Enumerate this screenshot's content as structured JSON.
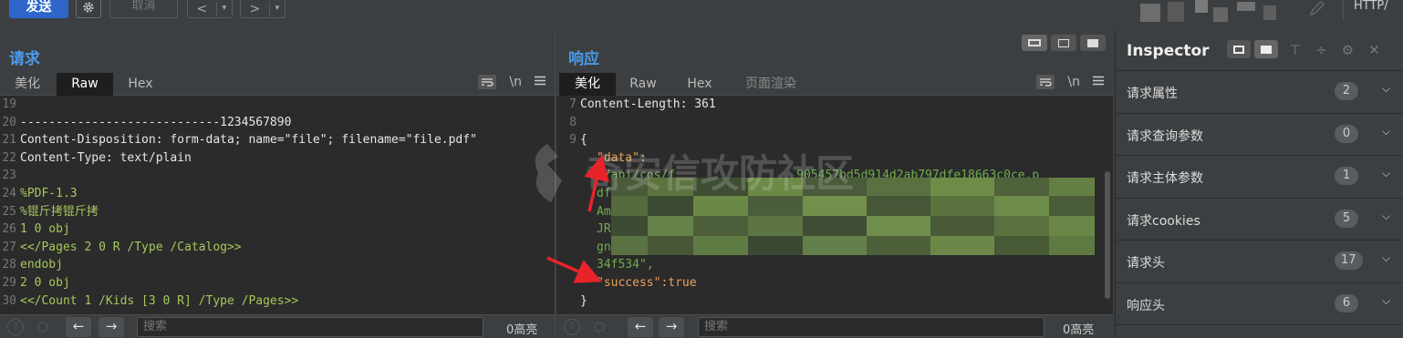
{
  "toolbar": {
    "send_label": "发送",
    "cancel_label": "取消",
    "back_label": "<",
    "forward_label": ">",
    "dropdown_label": "▾",
    "http_label": "HTTP/"
  },
  "request": {
    "title": "请求",
    "tabs": [
      "美化",
      "Raw",
      "Hex"
    ],
    "active_tab": "Raw",
    "newline_label": "\\n",
    "lines": [
      {
        "n": "19",
        "text": ""
      },
      {
        "n": "20",
        "text": "----------------------------1234567890"
      },
      {
        "n": "21",
        "text": "Content-Disposition: form-data; name=\"file\"; filename=\"file.pdf\""
      },
      {
        "n": "22",
        "text": "Content-Type: text/plain"
      },
      {
        "n": "23",
        "text": ""
      },
      {
        "n": "24",
        "text": "%PDF-1.3"
      },
      {
        "n": "25",
        "text": "%锟斤拷锟斤拷"
      },
      {
        "n": "26",
        "text": "1 0 obj"
      },
      {
        "n": "27",
        "text": "<</Pages 2 0 R /Type /Catalog>>"
      },
      {
        "n": "28",
        "text": "endobj"
      },
      {
        "n": "29",
        "text": "2 0 obj"
      },
      {
        "n": "30",
        "text": "<</Count 1 /Kids [3 0 R] /Type /Pages>>"
      }
    ],
    "search_placeholder": "搜索",
    "highlight_count": "0高亮"
  },
  "response": {
    "title": "响应",
    "tabs": [
      "美化",
      "Raw",
      "Hex",
      "页面渲染"
    ],
    "active_tab": "美化",
    "newline_label": "\\n",
    "lines": [
      {
        "n": "7",
        "text": "Content-Length: 361"
      },
      {
        "n": "8",
        "text": ""
      },
      {
        "n": "9",
        "text": "{"
      },
      {
        "n": "",
        "text": "\"data\":"
      },
      {
        "n": "",
        "text": "\"/api/cos/f                 905457bd5d914d2ab797dfe18663c0ce.p"
      },
      {
        "n": "",
        "text": "df"
      },
      {
        "n": "",
        "text": "Am"
      },
      {
        "n": "",
        "text": "JR"
      },
      {
        "n": "",
        "text": "gn"
      },
      {
        "n": "",
        "text": "34f534\","
      },
      {
        "n": "",
        "text": "\"success\":true"
      },
      {
        "n": "",
        "text": "}"
      }
    ],
    "search_placeholder": "搜索",
    "highlight_count": "0高亮"
  },
  "watermark_text": "奇安信攻防社区",
  "inspector": {
    "title": "Inspector",
    "rows": [
      {
        "label": "请求属性",
        "count": "2"
      },
      {
        "label": "请求查询参数",
        "count": "0"
      },
      {
        "label": "请求主体参数",
        "count": "1"
      },
      {
        "label": "请求cookies",
        "count": "5"
      },
      {
        "label": "请求头",
        "count": "17"
      },
      {
        "label": "响应头",
        "count": "6"
      }
    ]
  },
  "colors": {
    "send_button": "#2f65ca",
    "panel_title": "#4a9bea",
    "annotation_arrow": "#e8232a",
    "json_key": "#e9a15b",
    "json_string": "#6fae4c"
  }
}
